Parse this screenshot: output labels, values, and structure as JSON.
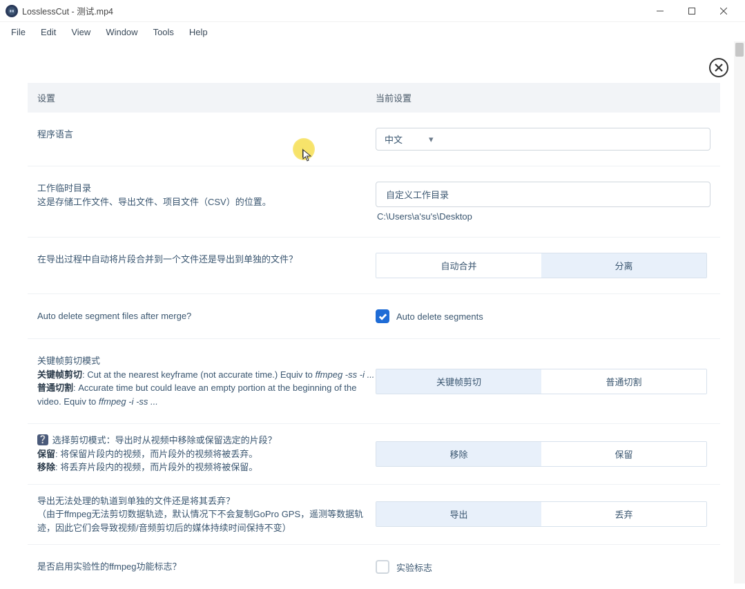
{
  "window": {
    "title": "LosslessCut - 测试.mp4"
  },
  "menu": {
    "file": "File",
    "edit": "Edit",
    "view": "View",
    "window": "Window",
    "tools": "Tools",
    "help": "Help"
  },
  "header": {
    "settings": "设置",
    "current": "当前设置"
  },
  "rows": {
    "language": {
      "label": "程序语言",
      "value": "中文"
    },
    "workdir": {
      "label": "工作临时目录",
      "desc": "这是存储工作文件、导出文件、项目文件（CSV）的位置。",
      "button": "自定义工作目录",
      "path": "C:\\Users\\a'su's\\Desktop"
    },
    "automerge": {
      "label": "在导出过程中自动将片段合并到一个文件还是导出到单独的文件？",
      "opt1": "自动合并",
      "opt2": "分离"
    },
    "autodelete": {
      "label": "Auto delete segment files after merge?",
      "cblabel": "Auto delete segments"
    },
    "keyframe": {
      "heading": "关键帧剪切模式",
      "bold1": "关键帧剪切",
      "text1": ": Cut at the nearest keyframe (not accurate time.) Equiv to ",
      "italic1": "ffmpeg -ss -i ...",
      "bold2": "普通切割",
      "text2": ": Accurate time but could leave an empty portion at the beginning of the video. Equiv to ",
      "italic2": "ffmpeg -i -ss ...",
      "opt1": "关键帧剪切",
      "opt2": "普通切割"
    },
    "cutmode": {
      "heading": "选择剪切模式：导出时从视频中移除或保留选定的片段？",
      "bold1": "保留",
      "text1": ": 将保留片段内的视频，而片段外的视频将被丢弃。",
      "bold2": "移除",
      "text2": ": 将丢弃片段内的视频，而片段外的视频将被保留。",
      "opt1": "移除",
      "opt2": "保留"
    },
    "extract": {
      "label": "导出无法处理的轨道到单独的文件还是将其丢弃？",
      "desc": "（由于ffmpeg无法剪切数据轨迹，默认情况下不会复制GoPro GPS，遥测等数据轨迹，因此它们会导致视频/音频剪切后的媒体持续时间保持不变）",
      "opt1": "导出",
      "opt2": "丢弃"
    },
    "experimental": {
      "label": "是否启用实验性的ffmpeg功能标志？",
      "cblabel": "实验标志"
    }
  }
}
